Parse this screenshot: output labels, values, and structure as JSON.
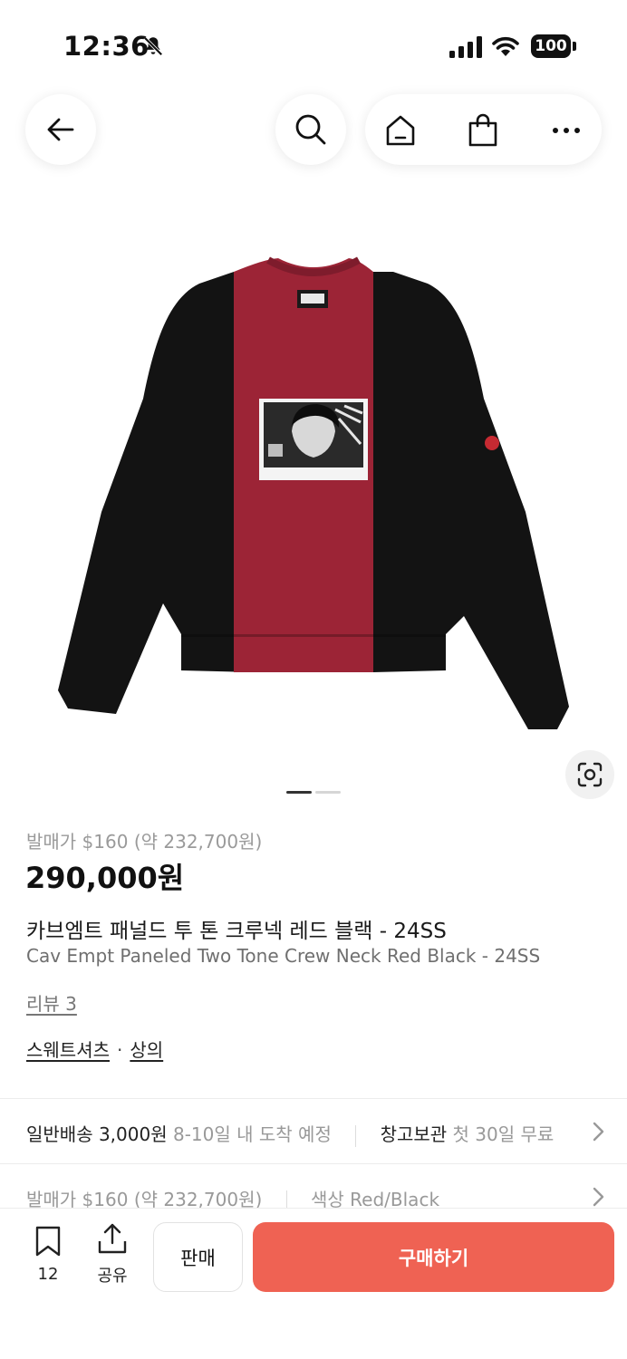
{
  "status_bar": {
    "time": "12:36",
    "battery": "100"
  },
  "product": {
    "release_price": "발매가 $160 (약 232,700원)",
    "price": "290,000원",
    "title_ko": "카브엠트 패널드 투 톤 크루넥 레드 블랙 - 24SS",
    "title_en": "Cav Empt Paneled Two Tone Crew Neck Red Black - 24SS",
    "review": "리뷰 3",
    "categories": [
      "스웨트셔츠",
      "상의"
    ],
    "category_separator": "·",
    "image_count": 2,
    "image_index": 1,
    "colors": {
      "red_panel": "#9c2436",
      "black_panel": "#131313"
    }
  },
  "delivery": {
    "type_label": "일반배송 3,000원",
    "eta": "8-10일 내 도착 예정",
    "storage_label": "창고보관",
    "storage_desc": "첫 30일 무료"
  },
  "detail_row": {
    "release_price": "발매가 $160 (약 232,700원)",
    "color_label": "색상",
    "color_value": "Red/Black"
  },
  "bottom_bar": {
    "bookmark_count": "12",
    "share_label": "공유",
    "sell_label": "판매",
    "buy_label": "구매하기"
  },
  "theme": {
    "accent": "#ef6253",
    "muted_text": "#999999"
  }
}
